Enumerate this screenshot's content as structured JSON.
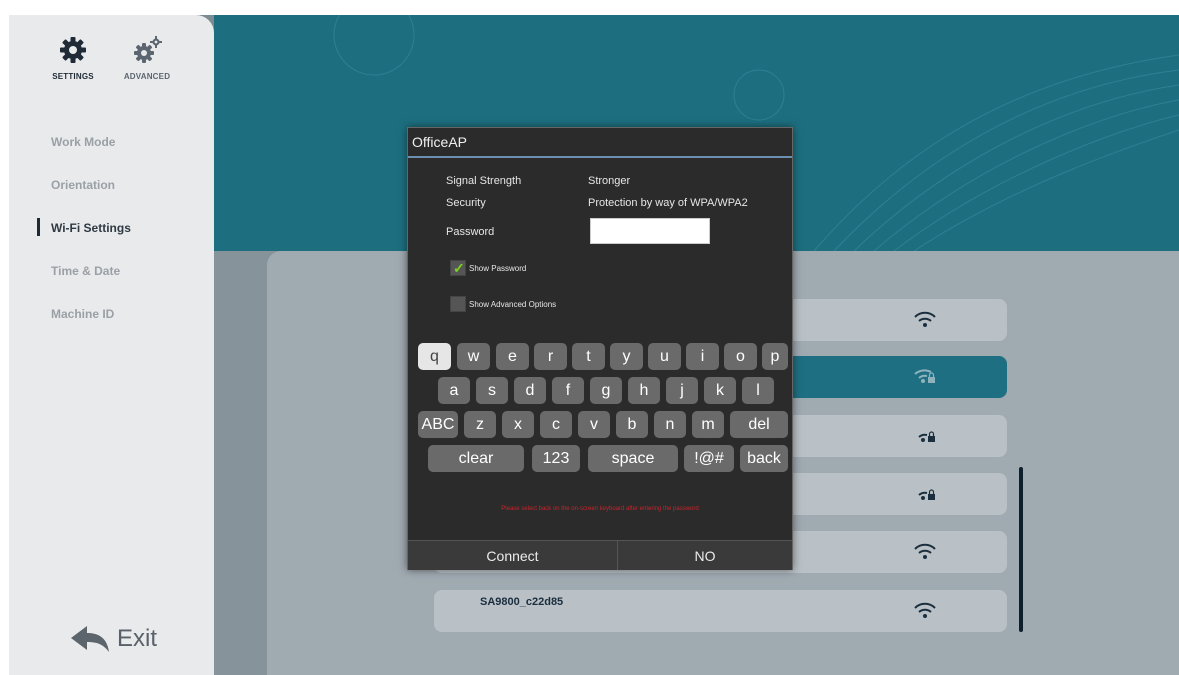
{
  "sidebar": {
    "settings_label": "SETTINGS",
    "advanced_label": "ADVANCED",
    "items": [
      {
        "label": "Work Mode"
      },
      {
        "label": "Orientation"
      },
      {
        "label": "Wi-Fi Settings"
      },
      {
        "label": "Time & Date"
      },
      {
        "label": "Machine ID"
      }
    ],
    "active_index": 2,
    "exit_label": "Exit"
  },
  "networks": {
    "visible_ssid": "SA9800_c22d85"
  },
  "dialog": {
    "title": "OfficeAP",
    "signal_label": "Signal Strength",
    "signal_value": "Stronger",
    "security_label": "Security",
    "security_value": "Protection by way of WPA/WPA2",
    "password_label": "Password",
    "password_value": "",
    "show_password_label": "Show Password",
    "show_password_checked": true,
    "show_advanced_label": "Show Advanced Options",
    "show_advanced_checked": false,
    "hint": "Please select back on the on-screen keyboard after entering the password",
    "connect_label": "Connect",
    "no_label": "NO"
  },
  "keyboard": {
    "row1": [
      "q",
      "w",
      "e",
      "r",
      "t",
      "y",
      "u",
      "i",
      "o",
      "p"
    ],
    "row2": [
      "a",
      "s",
      "d",
      "f",
      "g",
      "h",
      "j",
      "k",
      "l"
    ],
    "row3": [
      "ABC",
      "z",
      "x",
      "c",
      "v",
      "b",
      "n",
      "m",
      "del"
    ],
    "row4": [
      "clear",
      "123",
      "space",
      "!@#",
      "back"
    ],
    "highlighted_key": "q"
  },
  "colors": {
    "accent": "#1f6f83",
    "hint_red": "#c8242b",
    "check_green": "#7ed321"
  }
}
